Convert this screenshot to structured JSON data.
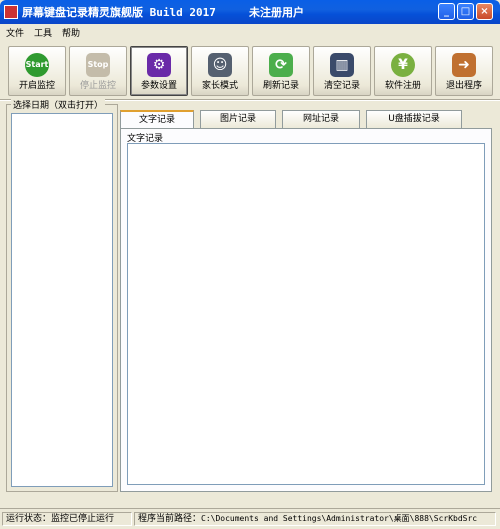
{
  "window": {
    "title": "屏幕键盘记录精灵旗舰版 Build 2017     未注册用户",
    "controls": {
      "minimize": "_",
      "maximize": "□",
      "close": "×"
    }
  },
  "menu": [
    "文件",
    "工具",
    "帮助"
  ],
  "toolbar": [
    {
      "label": "开启监控",
      "icon": "start-icon",
      "icon_text": "Start",
      "color": "#2f9a2f",
      "state": "normal"
    },
    {
      "label": "停止监控",
      "icon": "stop-icon",
      "icon_text": "Stop",
      "color": "#b8b0a0",
      "state": "disabled"
    },
    {
      "label": "参数设置",
      "icon": "settings-icon",
      "icon_text": "⚙",
      "color": "#6a2aa8",
      "state": "pressed"
    },
    {
      "label": "家长模式",
      "icon": "parent-icon",
      "icon_text": "☺",
      "color": "#556070",
      "state": "normal"
    },
    {
      "label": "刷新记录",
      "icon": "refresh-icon",
      "icon_text": "⟳",
      "color": "#4cae4c",
      "state": "normal"
    },
    {
      "label": "清空记录",
      "icon": "trash-icon",
      "icon_text": "▥",
      "color": "#3a4a6a",
      "state": "normal"
    },
    {
      "label": "软件注册",
      "icon": "yen-icon",
      "icon_text": "¥",
      "color": "#7ab040",
      "state": "normal"
    },
    {
      "label": "退出程序",
      "icon": "exit-icon",
      "icon_text": "➜",
      "color": "#c07030",
      "state": "normal"
    }
  ],
  "date_panel": {
    "label": "选择日期（双击打开）"
  },
  "tabs": [
    {
      "label": "文字记录",
      "active": true
    },
    {
      "label": "图片记录",
      "active": false
    },
    {
      "label": "网址记录",
      "active": false
    },
    {
      "label": "U盘插拔记录",
      "active": false
    }
  ],
  "panel": {
    "label": "文字记录",
    "content": ""
  },
  "status": {
    "state": "运行状态：监控已停止运行",
    "path_label": "程序当前路径：",
    "path": "C:\\Documents and Settings\\Administrator\\桌面\\888\\ScrKbdSrc"
  }
}
